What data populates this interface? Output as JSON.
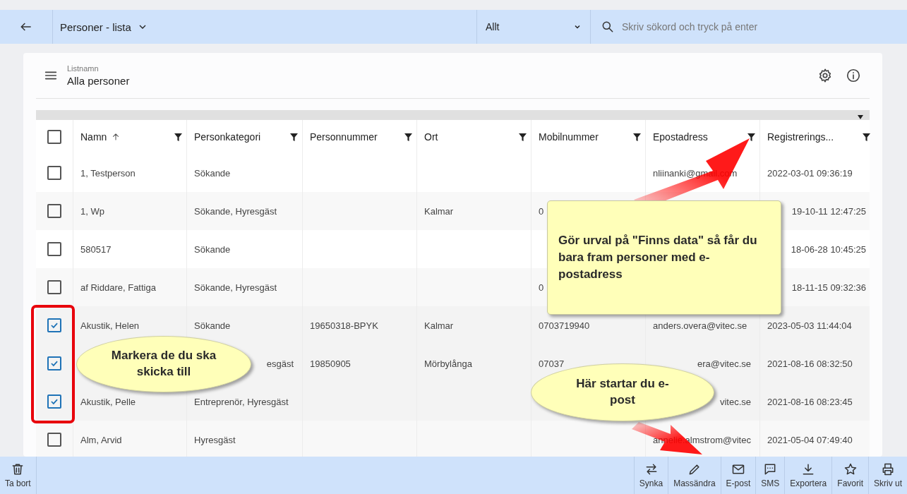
{
  "topbar": {
    "title": "Personer - lista",
    "filter": "Allt",
    "search": {
      "placeholder": "Skriv sökord och tryck på enter"
    }
  },
  "list": {
    "label": "Listnamn",
    "name": "Alla personer"
  },
  "table": {
    "all_selected": false,
    "columns": [
      {
        "label": "Namn",
        "sorted": true
      },
      {
        "label": "Personkategori",
        "sorted": false
      },
      {
        "label": "Personnummer",
        "sorted": false
      },
      {
        "label": "Ort",
        "sorted": false
      },
      {
        "label": "Mobilnummer",
        "sorted": false
      },
      {
        "label": "Epostadress",
        "sorted": false
      },
      {
        "label": "Registrerings...",
        "sorted": false
      }
    ],
    "rows": [
      {
        "selected": false,
        "cells": [
          "1, Testperson",
          "Sökande",
          "",
          "",
          "",
          "nliinanki@gmail.com",
          "2022-03-01 09:36:19"
        ]
      },
      {
        "selected": false,
        "cells": [
          "1, Wp",
          "Sökande, Hyresgäst",
          "",
          "Kalmar",
          "0",
          "",
          {
            "text": "19-10-11 12:47:25",
            "partial": true
          }
        ]
      },
      {
        "selected": false,
        "cells": [
          "580517",
          "Sökande",
          "",
          "",
          "",
          "",
          {
            "text": "18-06-28 10:45:25",
            "partial": true
          }
        ]
      },
      {
        "selected": false,
        "cells": [
          "af Riddare, Fattiga",
          "Sökande, Hyresgäst",
          "",
          "",
          "0",
          "",
          {
            "text": "18-11-15 09:32:36",
            "partial": true
          }
        ]
      },
      {
        "selected": true,
        "cells": [
          "Akustik, Helen",
          "Sökande",
          "19650318-BPYK",
          "Kalmar",
          "0703719940",
          "anders.overa@vitec.se",
          "2023-05-03 11:44:04"
        ]
      },
      {
        "selected": true,
        "cells": [
          "",
          {
            "text": "esgäst",
            "partial": true
          },
          "19850905",
          "Mörbylånga",
          "07037",
          {
            "text": "era@vitec.se",
            "partial": true
          },
          "2021-08-16 08:32:50"
        ]
      },
      {
        "selected": true,
        "cells": [
          "Akustik, Pelle",
          "Entreprenör, Hyresgäst",
          "",
          "",
          "",
          {
            "text": "vitec.se",
            "partial": true
          },
          "2021-08-16 08:23:45"
        ]
      },
      {
        "selected": false,
        "cells": [
          "Alm, Arvid",
          "Hyresgäst",
          "",
          "",
          "",
          "annelie.almstrom@vitec",
          "2021-05-04 07:49:40"
        ]
      }
    ]
  },
  "annotations": [
    {
      "kind": "note",
      "text": "Gör urval på \"Finns data\" så får du bara fram personer med e-postadress"
    },
    {
      "kind": "bubble",
      "text": "Markera de du ska skicka till"
    },
    {
      "kind": "bubble",
      "text": "Här startar du e-post"
    }
  ],
  "toolbar": {
    "left": [
      {
        "label": "Ta bort"
      }
    ],
    "right": [
      {
        "label": "Synka"
      },
      {
        "label": "Massändra"
      },
      {
        "label": "E-post"
      },
      {
        "label": "SMS"
      },
      {
        "label": "Exportera"
      },
      {
        "label": "Favorit"
      },
      {
        "label": "Skriv ut"
      }
    ]
  }
}
